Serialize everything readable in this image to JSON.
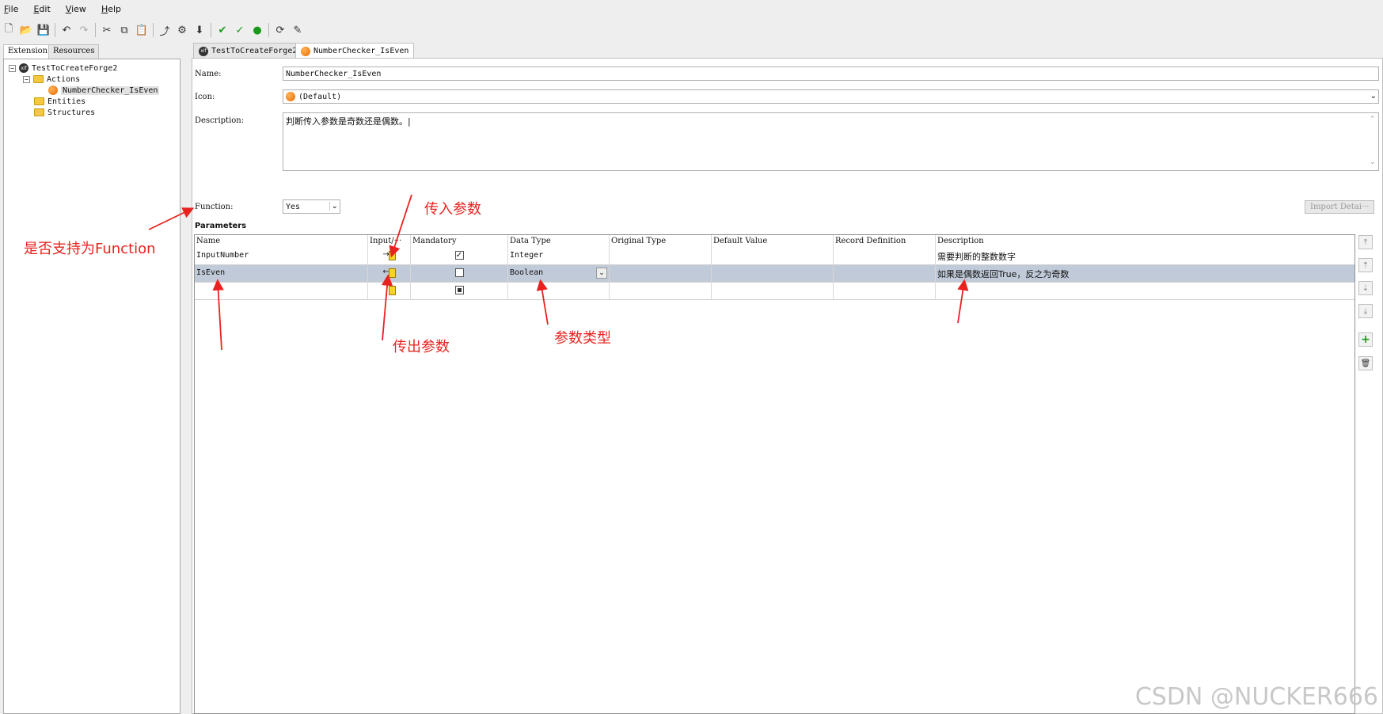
{
  "menu": [
    {
      "key": "F",
      "rest": "ile"
    },
    {
      "key": "E",
      "rest": "dit"
    },
    {
      "key": "V",
      "rest": "iew"
    },
    {
      "key": "H",
      "rest": "elp"
    }
  ],
  "toolbar": {
    "icons": [
      "new-file-icon",
      "open-folder-icon",
      "save-icon",
      "undo-icon",
      "redo-icon",
      "cut-icon",
      "copy-icon",
      "paste-icon",
      "publish-icon",
      "settings-icon",
      "download-icon",
      "verify-icon",
      "verify-save-icon",
      "info-icon",
      "refresh-icon",
      "refresh-edit-icon"
    ]
  },
  "left_tabs": [
    "Extension",
    "Resources"
  ],
  "tree": {
    "root": "TestToCreateForge2",
    "actions_label": "Actions",
    "action_item": "NumberChecker_IsEven",
    "entities_label": "Entities",
    "structures_label": "Structures"
  },
  "editor_tabs": [
    "TestToCreateForge2",
    "NumberChecker_IsEven"
  ],
  "form": {
    "name_label": "Name:",
    "name_value": "NumberChecker_IsEven",
    "icon_label": "Icon:",
    "icon_value": "(Default)",
    "description_label": "Description:",
    "description_value": "判断传入参数是奇数还是偶数。|",
    "function_label": "Function:",
    "function_value": "Yes",
    "import_button": "Import Detai···",
    "parameters_title": "Parameters"
  },
  "table": {
    "headers": [
      "Name",
      "Input/···",
      "Mandatory",
      "Data Type",
      "Original Type",
      "Default Value",
      "Record Definition",
      "Description"
    ],
    "rows": [
      {
        "name": "InputNumber",
        "direction": "input",
        "mandatory": "checked",
        "data_type": "Integer",
        "original_type": "",
        "default_value": "",
        "record_definition": "",
        "description": "需要判断的整数数字"
      },
      {
        "name": "IsEven",
        "direction": "output",
        "mandatory": "unchecked",
        "data_type": "Boolean",
        "original_type": "",
        "default_value": "",
        "record_definition": "",
        "description": "如果是偶数返回True，反之为奇数"
      },
      {
        "name": "",
        "direction": "input",
        "mandatory": "indeterminate",
        "data_type": "",
        "original_type": "",
        "default_value": "",
        "record_definition": "",
        "description": ""
      }
    ]
  },
  "annotations": {
    "function_support": "是否支持为Function",
    "input_param": "传入参数",
    "output_param": "传出参数",
    "param_type": "参数类型"
  },
  "watermark": "CSDN @NUCKER666",
  "colors": {
    "annotation": "#e8231f",
    "selected_row": "#c0cad8",
    "orange_icon": "#ea6a00",
    "folder": "#f4c841"
  }
}
